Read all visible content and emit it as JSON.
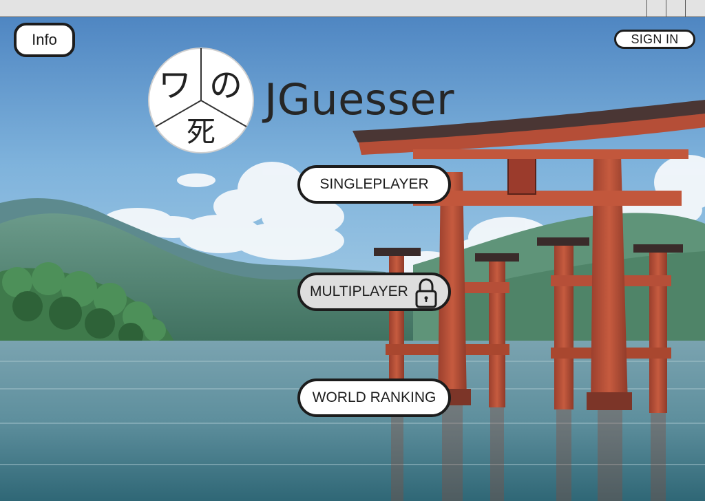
{
  "header": {
    "info_label": "Info",
    "signin_label": "SIGN IN"
  },
  "app": {
    "title": "JGuesser",
    "logo_glyphs": [
      "ワ",
      "の",
      "死"
    ]
  },
  "menu": {
    "singleplayer_label": "SINGLEPLAYER",
    "multiplayer_label": "MULTIPLAYER",
    "multiplayer_locked": true,
    "world_ranking_label": "WORLD RANKING"
  },
  "icons": {
    "lock": "lock-icon",
    "logo": "logo-icon"
  },
  "colors": {
    "button_bg": "#ffffff",
    "button_disabled_bg": "#dedede",
    "button_border": "#1c1c1c",
    "title_color": "#262626",
    "torii_red": "#c4563d"
  }
}
